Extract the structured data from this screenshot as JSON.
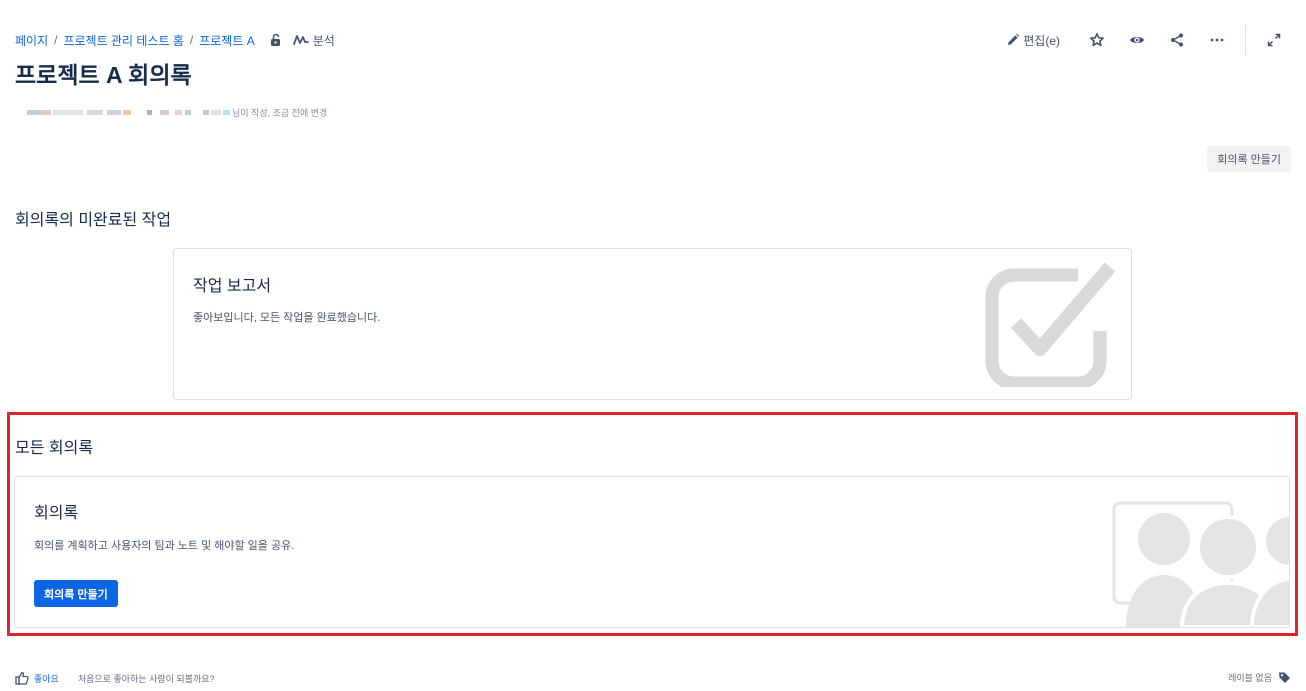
{
  "breadcrumb": {
    "items": [
      "페이지",
      "프로젝트 관리 테스트 홈",
      "프로젝트 A"
    ],
    "separator": "/",
    "analytics_label": "분석"
  },
  "toolbar": {
    "edit_label": "편집(e)"
  },
  "page": {
    "title": "프로젝트 A 회의록",
    "byline": "님이 작성, 조금 전에 변경"
  },
  "create_top_button": "회의록 만들기",
  "incomplete_section": {
    "heading": "회의록의 미완료된 작업",
    "card_title": "작업 보고서",
    "card_description": "좋아보입니다, 모든 작업을 완료했습니다."
  },
  "all_section": {
    "heading": "모든 회의록",
    "card_title": "회의록",
    "card_description": "회의를 계획하고 사용자의 팀과 노트 및 해야할 일을 공유.",
    "button_label": "회의록 만들기"
  },
  "footer": {
    "like_label": "좋아요",
    "like_hint": "처음으로 좋아하는 사람이 되볼까요?",
    "labels_text": "레이블 없음"
  },
  "colors": {
    "link": "#0c66e4",
    "primary": "#0c66e4",
    "highlight_border": "#e0242b",
    "illustration": "#d9d9d9"
  }
}
